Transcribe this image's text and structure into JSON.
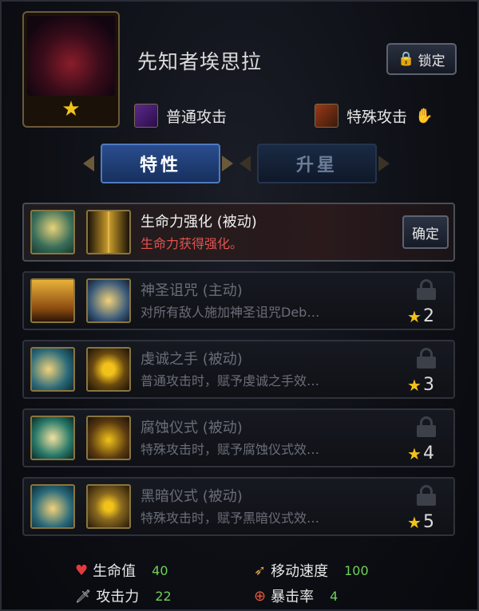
{
  "character": {
    "name": "先知者埃思拉",
    "stars": "★",
    "lock_label": "锁定"
  },
  "attacks": {
    "normal_label": "普通攻击",
    "special_label": "特殊攻击"
  },
  "tabs": [
    {
      "label": "特性",
      "active": true
    },
    {
      "label": "升星",
      "active": false
    }
  ],
  "traits": [
    {
      "name": "生命力强化 (被动)",
      "desc": "生命力获得强化。",
      "action": "确定",
      "unlocked": true
    },
    {
      "name": "神圣诅咒 (主动)",
      "desc": "对所有敌人施加神圣诅咒Deb…",
      "req_star": "★",
      "req": "2",
      "unlocked": false
    },
    {
      "name": "虔诚之手 (被动)",
      "desc": "普通攻击时，赋予虔诚之手效…",
      "req_star": "★",
      "req": "3",
      "unlocked": false
    },
    {
      "name": "腐蚀仪式 (被动)",
      "desc": "特殊攻击时，赋予腐蚀仪式效…",
      "req_star": "★",
      "req": "4",
      "unlocked": false
    },
    {
      "name": "黑暗仪式 (被动)",
      "desc": "特殊攻击时，赋予黑暗仪式效…",
      "req_star": "★",
      "req": "5",
      "unlocked": false
    }
  ],
  "stats": {
    "hp_label": "生命值",
    "hp_value": "40",
    "atk_label": "攻击力",
    "atk_value": "22",
    "speed_label": "移动速度",
    "speed_value": "100",
    "crit_label": "暴击率",
    "crit_value": "4"
  },
  "colors": {
    "accent_gold": "#f2c21b",
    "active_desc_red": "#e2534e",
    "stat_value_green": "#6fcf5a"
  }
}
